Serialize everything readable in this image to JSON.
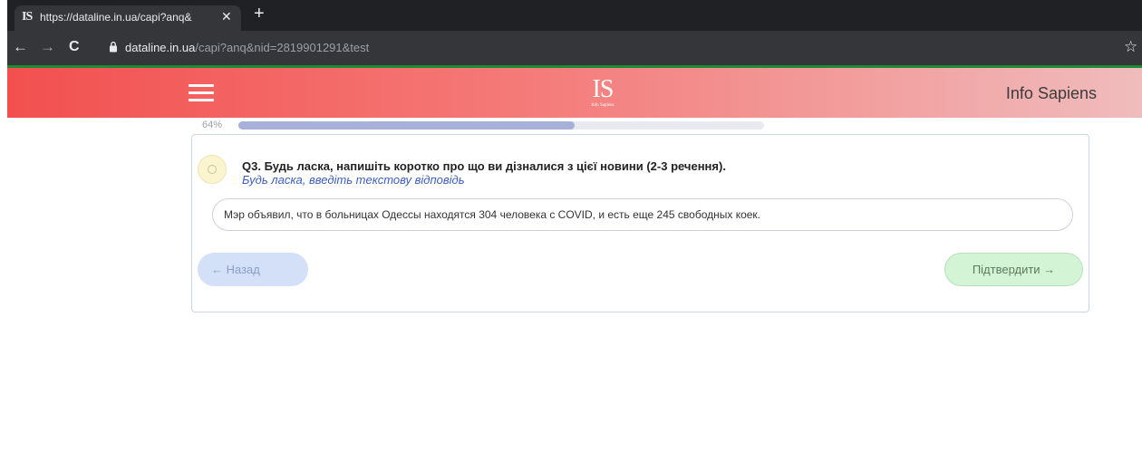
{
  "browser": {
    "tab_favicon": "IS",
    "tab_title": "https://dataline.in.ua/capi?anq&",
    "tab_close": "✕",
    "new_tab": "+",
    "nav_back": "←",
    "nav_forward": "→",
    "nav_reload": "C",
    "address_domain": "dataline.in.ua",
    "address_path": "/capi?anq&nid=2819901291&test",
    "bookmark_star": "☆"
  },
  "header": {
    "logo_text": "IS",
    "logo_subtext": "Info Sapiens",
    "brand": "Info Sapiens"
  },
  "progress": {
    "label": "64%",
    "value": 0.64
  },
  "question": {
    "title": "Q3. Будь ласка, напишіть коротко про що ви дізналися з цієї новини (2-3 речення).",
    "hint": "Будь ласка, введіть текстову відповідь",
    "answer_value": "Мэр объявил, что в больницах Одессы находятся 304 человека с COVID, и есть еще 245 свободных коек."
  },
  "buttons": {
    "back_label": "← Назад",
    "confirm_label": "Підтвердити →"
  },
  "colors": {
    "header_start": "#f2504f",
    "header_end": "#f0bcbd",
    "progress_fill": "#a6b0d8",
    "hint_text": "#3b5fc0",
    "confirm_bg": "#d3f4d5",
    "back_bg": "#d4e0f8"
  }
}
